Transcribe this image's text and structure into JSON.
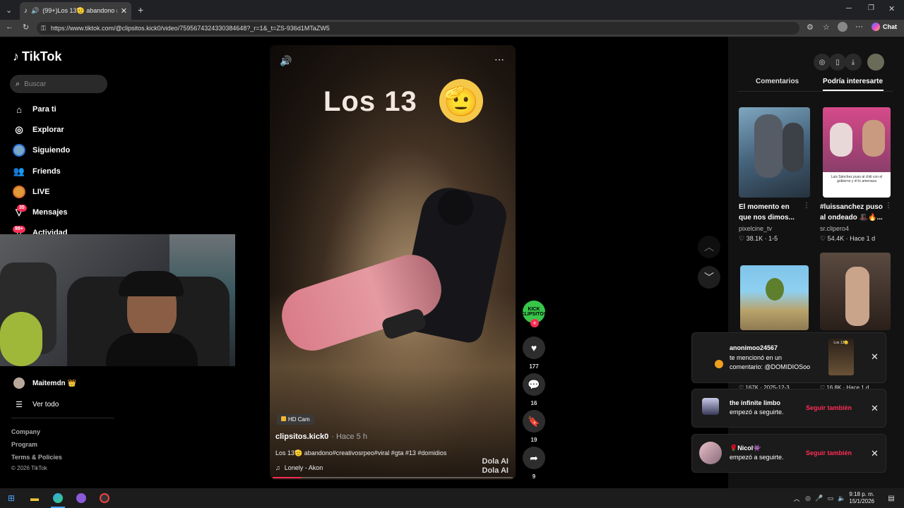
{
  "browser": {
    "tab_title": "(99+)Los 13🫡 abandono #cı",
    "url": "https://www.tiktok.com/@clipsitos.kick0/video/7595674324330384648?_r=1&_t=ZS-936d1MTaZW5",
    "chat_label": "Chat"
  },
  "sidebar": {
    "logo": "TikTok",
    "search_placeholder": "Buscar",
    "items": [
      {
        "label": "Para ti",
        "icon": "home-icon"
      },
      {
        "label": "Explorar",
        "icon": "compass-icon"
      },
      {
        "label": "Siguiendo",
        "icon": "following-avatar-icon"
      },
      {
        "label": "Friends",
        "icon": "friends-icon"
      },
      {
        "label": "LIVE",
        "icon": "live-icon"
      },
      {
        "label": "Mensajes",
        "icon": "messages-icon",
        "badge": "35"
      },
      {
        "label": "Actividad",
        "icon": "activity-icon",
        "badge": "99+"
      }
    ],
    "following_user": "Maitemdn 👑",
    "see_all": "Ver todo",
    "footer": [
      "Company",
      "Program",
      "Terms & Policies",
      "© 2026 TikTok"
    ]
  },
  "video": {
    "overlay_title": "Los 13",
    "hd_badge": "HD Cam",
    "author": "clipsitos.kick0",
    "posted": "· Hace 5 h",
    "caption": "Los 13🫡 abandono#creativosrpeo#viral #gta #13 #domidios",
    "music": "Lonely - Akon",
    "watermark_1": "Dola AI",
    "watermark_2": "Dola AI",
    "progress": 0.12
  },
  "actions": {
    "avatar_label": "KICK CLIPSITOS",
    "likes": "177",
    "comments": "16",
    "saves": "19",
    "shares": "9"
  },
  "right_panel": {
    "tabs": [
      "Comentarios",
      "Podría interesarte"
    ],
    "active_tab": "Podría interesarte",
    "videos": [
      {
        "title": "El momento en que nos dimos...",
        "user": "pixelcine_tv",
        "stats": "♡ 38.1K · 1-5"
      },
      {
        "title": "#luissanchez puso al ondeado 🎩🔥...",
        "user": "sr.clipero4",
        "stats": "♡ 54.4K · Hace 1 d"
      },
      {
        "title": "",
        "user": "",
        "stats": "♡ 167K · 2025-12-3"
      },
      {
        "title": "",
        "user": "",
        "stats": "♡ 16.8K · Hace 1 d"
      }
    ],
    "thumb2_caption": "Luis Sánchez puso al chiti con el gobierno y él lo amenaza"
  },
  "notifications": [
    {
      "user": "anonimoo24567",
      "text_1": "te mencionó en un",
      "text_2": "comentario: @DOMIDIOSoo",
      "thumb_label": "Los 13🫡"
    },
    {
      "user": "the infinite limbo",
      "text_1": "empezó a seguirte.",
      "action": "Seguir también"
    },
    {
      "user": "🌹Nicol👾",
      "text_1": "empezó a seguirte.",
      "action": "Seguir también"
    }
  ],
  "taskbar": {
    "time": "9:18 p. m.",
    "date": "15/1/2026"
  }
}
